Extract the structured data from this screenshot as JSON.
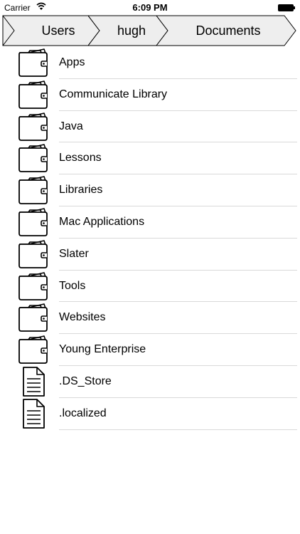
{
  "status_bar": {
    "carrier": "Carrier",
    "time": "6:09 PM",
    "wifi_icon": "wifi-icon",
    "battery_icon": "battery-icon"
  },
  "breadcrumb": {
    "items": [
      "Users",
      "hugh",
      "Documents"
    ],
    "fill_color": "#eeeeee",
    "stroke_color": "#000000"
  },
  "files": [
    {
      "name": "Apps",
      "type": "folder",
      "icon": "folder-icon"
    },
    {
      "name": "Communicate Library",
      "type": "folder",
      "icon": "folder-icon"
    },
    {
      "name": "Java",
      "type": "folder",
      "icon": "folder-icon"
    },
    {
      "name": "Lessons",
      "type": "folder",
      "icon": "folder-icon"
    },
    {
      "name": "Libraries",
      "type": "folder",
      "icon": "folder-icon"
    },
    {
      "name": "Mac Applications",
      "type": "folder",
      "icon": "folder-icon"
    },
    {
      "name": "Slater",
      "type": "folder",
      "icon": "folder-icon"
    },
    {
      "name": "Tools",
      "type": "folder",
      "icon": "folder-icon"
    },
    {
      "name": "Websites",
      "type": "folder",
      "icon": "folder-icon"
    },
    {
      "name": "Young Enterprise",
      "type": "folder",
      "icon": "folder-icon"
    },
    {
      "name": ".DS_Store",
      "type": "file",
      "icon": "document-icon"
    },
    {
      "name": ".localized",
      "type": "file",
      "icon": "document-icon"
    }
  ]
}
